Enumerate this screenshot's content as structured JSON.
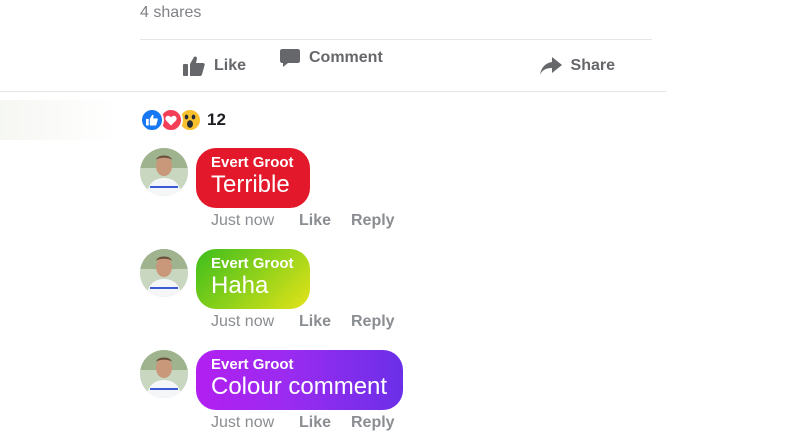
{
  "post": {
    "shares": "4 shares"
  },
  "actions": {
    "like": "Like",
    "comment": "Comment",
    "share": "Share"
  },
  "reactions": {
    "icons": [
      "like-icon",
      "love-icon",
      "wow-icon"
    ],
    "count": "12"
  },
  "comments": [
    {
      "author": "Evert Groot",
      "text": "Terrible",
      "time": "Just now",
      "like": "Like",
      "reply": "Reply",
      "color": "#e3182b"
    },
    {
      "author": "Evert Groot",
      "text": "Haha",
      "time": "Just now",
      "like": "Like",
      "reply": "Reply",
      "color": "#8fd11a"
    },
    {
      "author": "Evert Groot",
      "text": "Colour comment",
      "time": "Just now",
      "like": "Like",
      "reply": "Reply",
      "color": "#a024f0"
    }
  ],
  "colors": {
    "like_blue": "#1877f2",
    "love_red": "#f33e58",
    "wow_yellow": "#f7c02f",
    "action_gray": "#65676b"
  }
}
